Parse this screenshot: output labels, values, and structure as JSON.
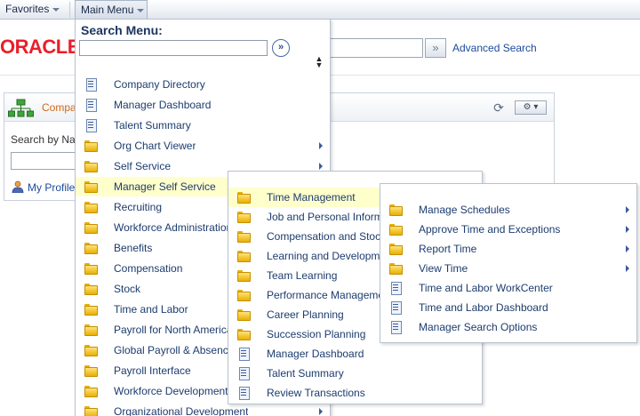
{
  "navbar": {
    "favorites": "Favorites",
    "main_menu": "Main Menu"
  },
  "header": {
    "logo": "ORACLE",
    "search_button": "»",
    "advanced_search": "Advanced Search"
  },
  "pagelet": {
    "title": "Compa",
    "search_by_label": "Search by Na",
    "my_profile": "My Profile"
  },
  "main_menu": {
    "search_title": "Search Menu:",
    "search_placeholder": "",
    "search_go": "»",
    "items": [
      {
        "label": "Company Directory",
        "icon": "page-icon",
        "submenu": false
      },
      {
        "label": "Manager Dashboard",
        "icon": "page-icon",
        "submenu": false
      },
      {
        "label": "Talent Summary",
        "icon": "page-icon",
        "submenu": false
      },
      {
        "label": "Org Chart Viewer",
        "icon": "folder-icon",
        "submenu": true
      },
      {
        "label": "Self Service",
        "icon": "folder-icon",
        "submenu": true
      },
      {
        "label": "Manager Self Service",
        "icon": "folder-icon",
        "submenu": true,
        "highlighted": true
      },
      {
        "label": "Recruiting",
        "icon": "folder-icon",
        "submenu": true
      },
      {
        "label": "Workforce Administration",
        "icon": "folder-icon",
        "submenu": true
      },
      {
        "label": "Benefits",
        "icon": "folder-icon",
        "submenu": true
      },
      {
        "label": "Compensation",
        "icon": "folder-icon",
        "submenu": true
      },
      {
        "label": "Stock",
        "icon": "folder-icon",
        "submenu": true
      },
      {
        "label": "Time and Labor",
        "icon": "folder-icon",
        "submenu": true
      },
      {
        "label": "Payroll for North America",
        "icon": "folder-icon",
        "submenu": true
      },
      {
        "label": "Global Payroll & Absence Mgmt",
        "icon": "folder-icon",
        "submenu": true
      },
      {
        "label": "Payroll Interface",
        "icon": "folder-icon",
        "submenu": true
      },
      {
        "label": "Workforce Development",
        "icon": "folder-icon",
        "submenu": true
      },
      {
        "label": "Organizational Development",
        "icon": "folder-icon",
        "submenu": true
      }
    ]
  },
  "manager_self_service_menu": {
    "items": [
      {
        "label": "Time Management",
        "icon": "folder-icon",
        "highlighted": true
      },
      {
        "label": "Job and Personal Information",
        "icon": "folder-icon"
      },
      {
        "label": "Compensation and Stock",
        "icon": "folder-icon"
      },
      {
        "label": "Learning and Development",
        "icon": "folder-icon"
      },
      {
        "label": "Team Learning",
        "icon": "folder-icon"
      },
      {
        "label": "Performance Management",
        "icon": "folder-icon"
      },
      {
        "label": "Career Planning",
        "icon": "folder-icon"
      },
      {
        "label": "Succession Planning",
        "icon": "folder-icon"
      },
      {
        "label": "Manager Dashboard",
        "icon": "page-icon"
      },
      {
        "label": "Talent Summary",
        "icon": "page-icon"
      },
      {
        "label": "Review Transactions",
        "icon": "page-icon"
      }
    ]
  },
  "time_management_menu": {
    "items": [
      {
        "label": "Manage Schedules",
        "icon": "folder-icon",
        "submenu": true
      },
      {
        "label": "Approve Time and Exceptions",
        "icon": "folder-icon",
        "submenu": true
      },
      {
        "label": "Report Time",
        "icon": "folder-icon",
        "submenu": true
      },
      {
        "label": "View Time",
        "icon": "folder-icon",
        "submenu": true
      },
      {
        "label": "Time and Labor WorkCenter",
        "icon": "page-icon",
        "submenu": false
      },
      {
        "label": "Time and Labor Dashboard",
        "icon": "page-icon",
        "submenu": false
      },
      {
        "label": "Manager Search Options",
        "icon": "page-icon",
        "submenu": false
      }
    ]
  }
}
